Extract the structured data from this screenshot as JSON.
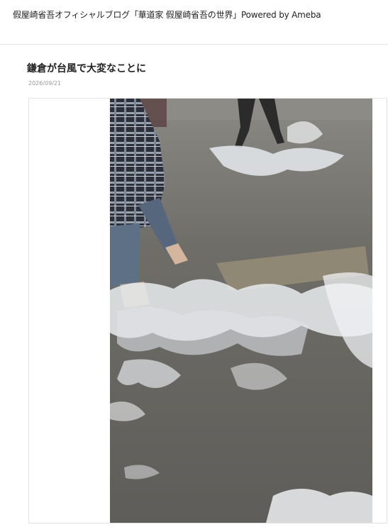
{
  "header": {
    "blog_title": "假屋崎省吾オフィシャルブログ「華道家 假屋崎省吾の世界」Powered by Ameba"
  },
  "article": {
    "title": "鎌倉が台風で大変なことに",
    "date": "2026/09/21"
  },
  "photo": {
    "colors": {
      "pavement": "#6e6c68",
      "water_foam": "#e9ecef",
      "jeans": "#5d7086",
      "plaid_dark": "#2a2f3a"
    }
  }
}
